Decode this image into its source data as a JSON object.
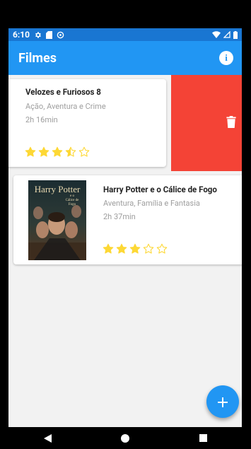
{
  "status_bar": {
    "time": "6:10"
  },
  "app_bar": {
    "title": "Filmes",
    "info_label": "i"
  },
  "movies": [
    {
      "title": "Velozes e Furiosos 8",
      "genre": "Ação, Aventura e Crime",
      "duration": "2h 16min",
      "rating": 3.5,
      "swiped": true
    },
    {
      "title": "Harry Potter e o Cálice de Fogo",
      "genre": "Aventura, Família e Fantasia",
      "duration": "2h 37min",
      "rating": 3,
      "poster": {
        "title_line1": "Harry Potter",
        "title_line2": "e o",
        "title_line3": "Cálice de",
        "title_line4": "Fogo"
      }
    }
  ],
  "colors": {
    "primary": "#2196F3",
    "primary_dark": "#1976D2",
    "delete": "#F44336",
    "star": "#FDD835"
  },
  "icons": {
    "delete": "trash-icon",
    "info": "info-icon",
    "add": "plus-icon"
  }
}
